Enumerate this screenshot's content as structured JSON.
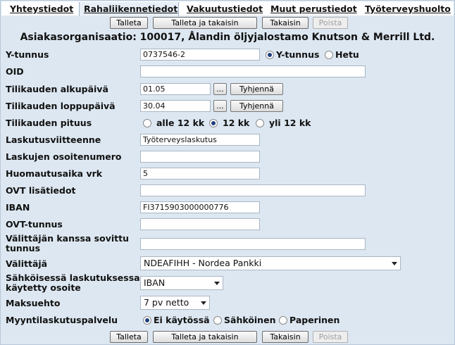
{
  "tabs": [
    "Yhteystiedot",
    "Rahaliikennetiedot",
    "Vakuutustiedot",
    "Muut perustiedot",
    "Työterveyshuolto"
  ],
  "buttons": {
    "save": "Talleta",
    "save_back": "Talleta ja takaisin",
    "back": "Takaisin",
    "delete": "Poista"
  },
  "org_title": "Asiakasorganisaatio: 100017, Ålandin öljyjalostamo Knutson & Merrill Ltd.",
  "fields": {
    "ytunnus": {
      "label": "Y-tunnus",
      "value": "0737546-2",
      "opt1": "Y-tunnus",
      "opt2": "Hetu"
    },
    "oid": {
      "label": "OID",
      "value": ""
    },
    "alku": {
      "label": "Tilikauden alkupäivä",
      "value": "01.05",
      "picker": "...",
      "clear": "Tyhjennä"
    },
    "loppu": {
      "label": "Tilikauden loppupäivä",
      "value": "30.04",
      "picker": "...",
      "clear": "Tyhjennä"
    },
    "pituus": {
      "label": "Tilikauden pituus",
      "opts": [
        "alle 12 kk",
        "12 kk",
        "yli 12 kk"
      ]
    },
    "viite": {
      "label": "Laskutusviitteenne",
      "value": "Työterveyslaskutus"
    },
    "osoitenro": {
      "label": "Laskujen osoitenumero",
      "value": ""
    },
    "huom": {
      "label": "Huomautusaika vrk",
      "value": "5"
    },
    "ovtlisa": {
      "label": "OVT lisätiedot",
      "value": ""
    },
    "iban": {
      "label": "IBAN",
      "value": "FI3715903000000776"
    },
    "ovt": {
      "label": "OVT-tunnus",
      "value": ""
    },
    "sovittu": {
      "label1": "Välittäjän kanssa sovittu",
      "label2": "tunnus",
      "value": ""
    },
    "valittaja": {
      "label": "Välittäjä",
      "value": "NDEAFIHH - Nordea Pankki"
    },
    "sahk": {
      "label1": "Sähköisessä laskutuksessa",
      "label2": "käytetty osoite",
      "value": "IBAN"
    },
    "maksu": {
      "label": "Maksuehto",
      "value": "7 pv netto"
    },
    "myynti": {
      "label": "Myyntilaskutuspalvelu",
      "opts": [
        "Ei käytössä",
        "Sähköinen",
        "Paperinen"
      ]
    }
  },
  "colors": {
    "panel": "#dde7f1",
    "radio_dot": "#1f3f7a"
  }
}
